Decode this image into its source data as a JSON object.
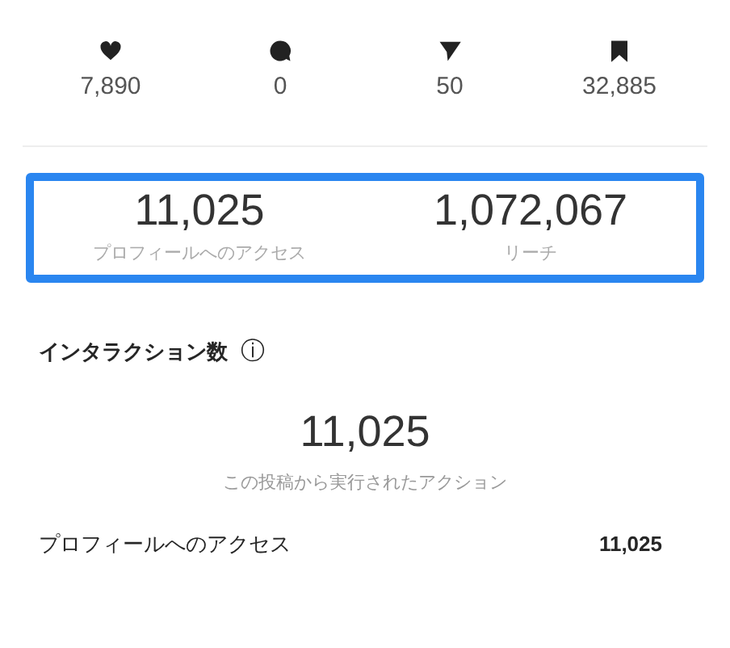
{
  "stats": [
    {
      "kind": "heart",
      "value": "7,890"
    },
    {
      "kind": "comment",
      "value": "0"
    },
    {
      "kind": "share",
      "value": "50"
    },
    {
      "kind": "save",
      "value": "32,885"
    }
  ],
  "summary": {
    "highlighted": true,
    "metrics": [
      {
        "value": "11,025",
        "label": "プロフィールへのアクセス"
      },
      {
        "value": "1,072,067",
        "label": "リーチ"
      }
    ]
  },
  "interactions": {
    "title": "インタラクション数",
    "info_icon": "ⓘ",
    "total": "11,025",
    "caption": "この投稿から実行されたアクション",
    "rows": [
      {
        "label": "プロフィールへのアクセス",
        "value": "11,025"
      }
    ]
  }
}
